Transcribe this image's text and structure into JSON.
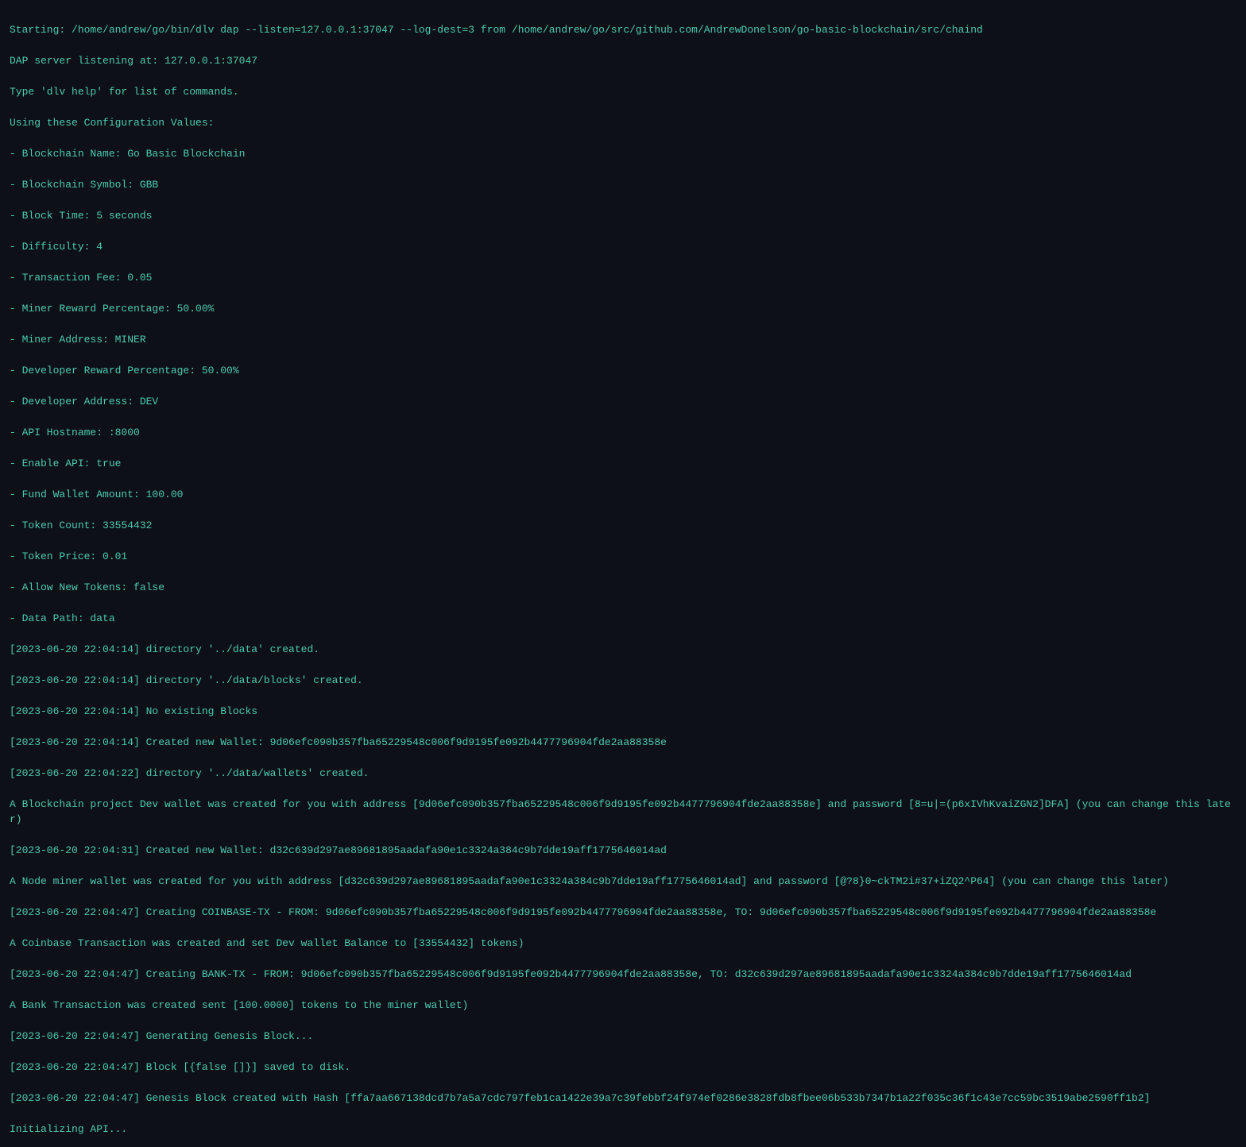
{
  "terminal": {
    "lines": [
      {
        "text": "Starting: /home/andrew/go/bin/dlv dap --listen=127.0.0.1:37047 --log-dest=3 from /home/andrew/go/src/github.com/AndrewDonelson/go-basic-blockchain/src/chaind",
        "class": "cyan"
      },
      {
        "text": "DAP server listening at: 127.0.0.1:37047",
        "class": "cyan"
      },
      {
        "text": "Type 'dlv help' for list of commands.",
        "class": "cyan"
      },
      {
        "text": "Using these Configuration Values:",
        "class": "cyan"
      },
      {
        "text": "- Blockchain Name: Go Basic Blockchain",
        "class": "cyan"
      },
      {
        "text": "- Blockchain Symbol: GBB",
        "class": "cyan"
      },
      {
        "text": "- Block Time: 5 seconds",
        "class": "cyan"
      },
      {
        "text": "- Difficulty: 4",
        "class": "cyan"
      },
      {
        "text": "- Transaction Fee: 0.05",
        "class": "cyan"
      },
      {
        "text": "- Miner Reward Percentage: 50.00%",
        "class": "cyan"
      },
      {
        "text": "- Miner Address: MINER",
        "class": "cyan"
      },
      {
        "text": "- Developer Reward Percentage: 50.00%",
        "class": "cyan"
      },
      {
        "text": "- Developer Address: DEV",
        "class": "cyan"
      },
      {
        "text": "- API Hostname: :8000",
        "class": "cyan"
      },
      {
        "text": "- Enable API: true",
        "class": "cyan"
      },
      {
        "text": "- Fund Wallet Amount: 100.00",
        "class": "cyan"
      },
      {
        "text": "- Token Count: 33554432",
        "class": "cyan"
      },
      {
        "text": "- Token Price: 0.01",
        "class": "cyan"
      },
      {
        "text": "- Allow New Tokens: false",
        "class": "cyan"
      },
      {
        "text": "- Data Path: data",
        "class": "cyan"
      },
      {
        "text": "[2023-06-20 22:04:14] directory '../data' created.",
        "class": "cyan"
      },
      {
        "text": "[2023-06-20 22:04:14] directory '../data/blocks' created.",
        "class": "cyan"
      },
      {
        "text": "[2023-06-20 22:04:14] No existing Blocks",
        "class": "cyan"
      },
      {
        "text": "[2023-06-20 22:04:14] Created new Wallet: 9d06efc090b357fba65229548c006f9d9195fe092b4477796904fde2aa88358e",
        "class": "cyan"
      },
      {
        "text": "[2023-06-20 22:04:22] directory '../data/wallets' created.",
        "class": "cyan"
      },
      {
        "text": "A Blockchain project Dev wallet was created for you with address [9d06efc090b357fba65229548c006f9d9195fe092b4477796904fde2aa88358e] and password [8=u|=(p6xIVhKvaiZGN2]DFA] (you can change this later)",
        "class": "cyan"
      },
      {
        "text": "[2023-06-20 22:04:31] Created new Wallet: d32c639d297ae89681895aadafa90e1c3324a384c9b7dde19aff1775646014ad",
        "class": "cyan"
      },
      {
        "text": "A Node miner wallet was created for you with address [d32c639d297ae89681895aadafa90e1c3324a384c9b7dde19aff1775646014ad] and password [@?8}0~ckTM2i#37+iZQ2^P64] (you can change this later)",
        "class": "cyan"
      },
      {
        "text": "[2023-06-20 22:04:47] Creating COINBASE-TX - FROM: 9d06efc090b357fba65229548c006f9d9195fe092b4477796904fde2aa88358e, TO: 9d06efc090b357fba65229548c006f9d9195fe092b4477796904fde2aa88358e",
        "class": "cyan"
      },
      {
        "text": "A Coinbase Transaction was created and set Dev wallet Balance to [33554432] tokens)",
        "class": "cyan"
      },
      {
        "text": "[2023-06-20 22:04:47] Creating BANK-TX - FROM: 9d06efc090b357fba65229548c006f9d9195fe092b4477796904fde2aa88358e, TO: d32c639d297ae89681895aadafa90e1c3324a384c9b7dde19aff1775646014ad",
        "class": "cyan"
      },
      {
        "text": "A Bank Transaction was created sent [100.0000] tokens to the miner wallet)",
        "class": "cyan"
      },
      {
        "text": "[2023-06-20 22:04:47] Generating Genesis Block...",
        "class": "cyan"
      },
      {
        "text": "[2023-06-20 22:04:47] Block [{false []}] saved to disk.",
        "class": "cyan"
      },
      {
        "text": "[2023-06-20 22:04:47] Genesis Block created with Hash [ffa7aa667138dcd7b7a5a7cdc797feb1ca1422e39a7c39febbf24f974ef0286e3828fdb8fbee06b533b7347b1a22f035c36f1c43e7cc59bc3519abe2590ff1b2]",
        "class": "cyan"
      },
      {
        "text": "Initializing API...",
        "class": "cyan"
      }
    ]
  }
}
